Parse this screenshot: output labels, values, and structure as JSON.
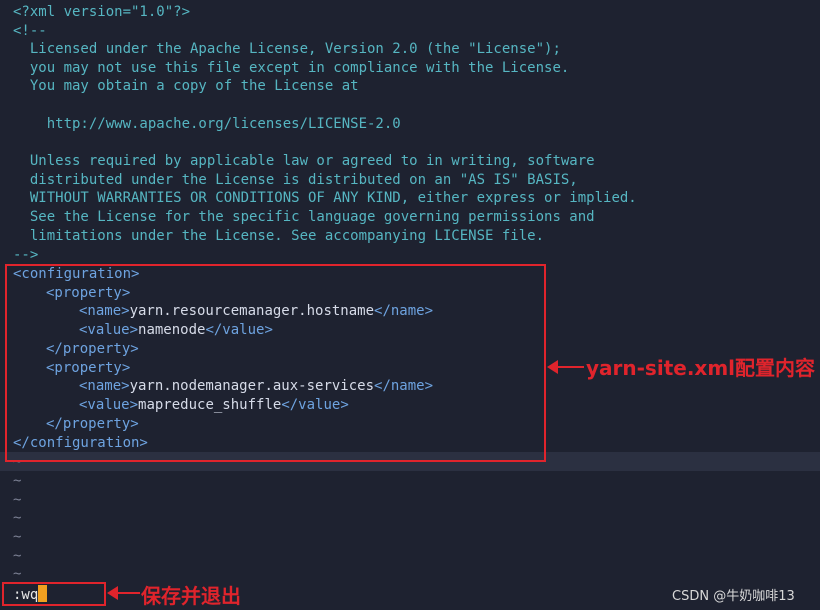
{
  "editor": {
    "header_lines": [
      "<?xml version=\"1.0\"?>",
      "<!--",
      "  Licensed under the Apache License, Version 2.0 (the \"License\");",
      "  you may not use this file except in compliance with the License.",
      "  You may obtain a copy of the License at",
      "",
      "    http://www.apache.org/licenses/LICENSE-2.0",
      "",
      "  Unless required by applicable law or agreed to in writing, software",
      "  distributed under the License is distributed on an \"AS IS\" BASIS,",
      "  WITHOUT WARRANTIES OR CONDITIONS OF ANY KIND, either express or implied.",
      "  See the License for the specific language governing permissions and",
      "  limitations under the License. See accompanying LICENSE file.",
      "-->"
    ],
    "config": {
      "open_tag": "<configuration>",
      "close_tag": "</configuration>",
      "property_open": "<property>",
      "property_close": "</property>",
      "name_open": "<name>",
      "name_close": "</name>",
      "value_open": "<value>",
      "value_close": "</value>",
      "properties": [
        {
          "name": "yarn.resourcemanager.hostname",
          "value": "namenode"
        },
        {
          "name": "yarn.nodemanager.aux-services",
          "value": "mapreduce_shuffle"
        }
      ]
    },
    "tilde": "~"
  },
  "annotations": {
    "config_label": "yarn-site.xml配置内容",
    "save_label": "保存并退出"
  },
  "command_line": {
    "text": ":wq"
  },
  "watermark": "CSDN @牛奶咖啡13",
  "colors": {
    "background": "#1e2230",
    "comment": "#56b6c2",
    "tag": "#6ea3e0",
    "annotation": "#e0242c"
  }
}
